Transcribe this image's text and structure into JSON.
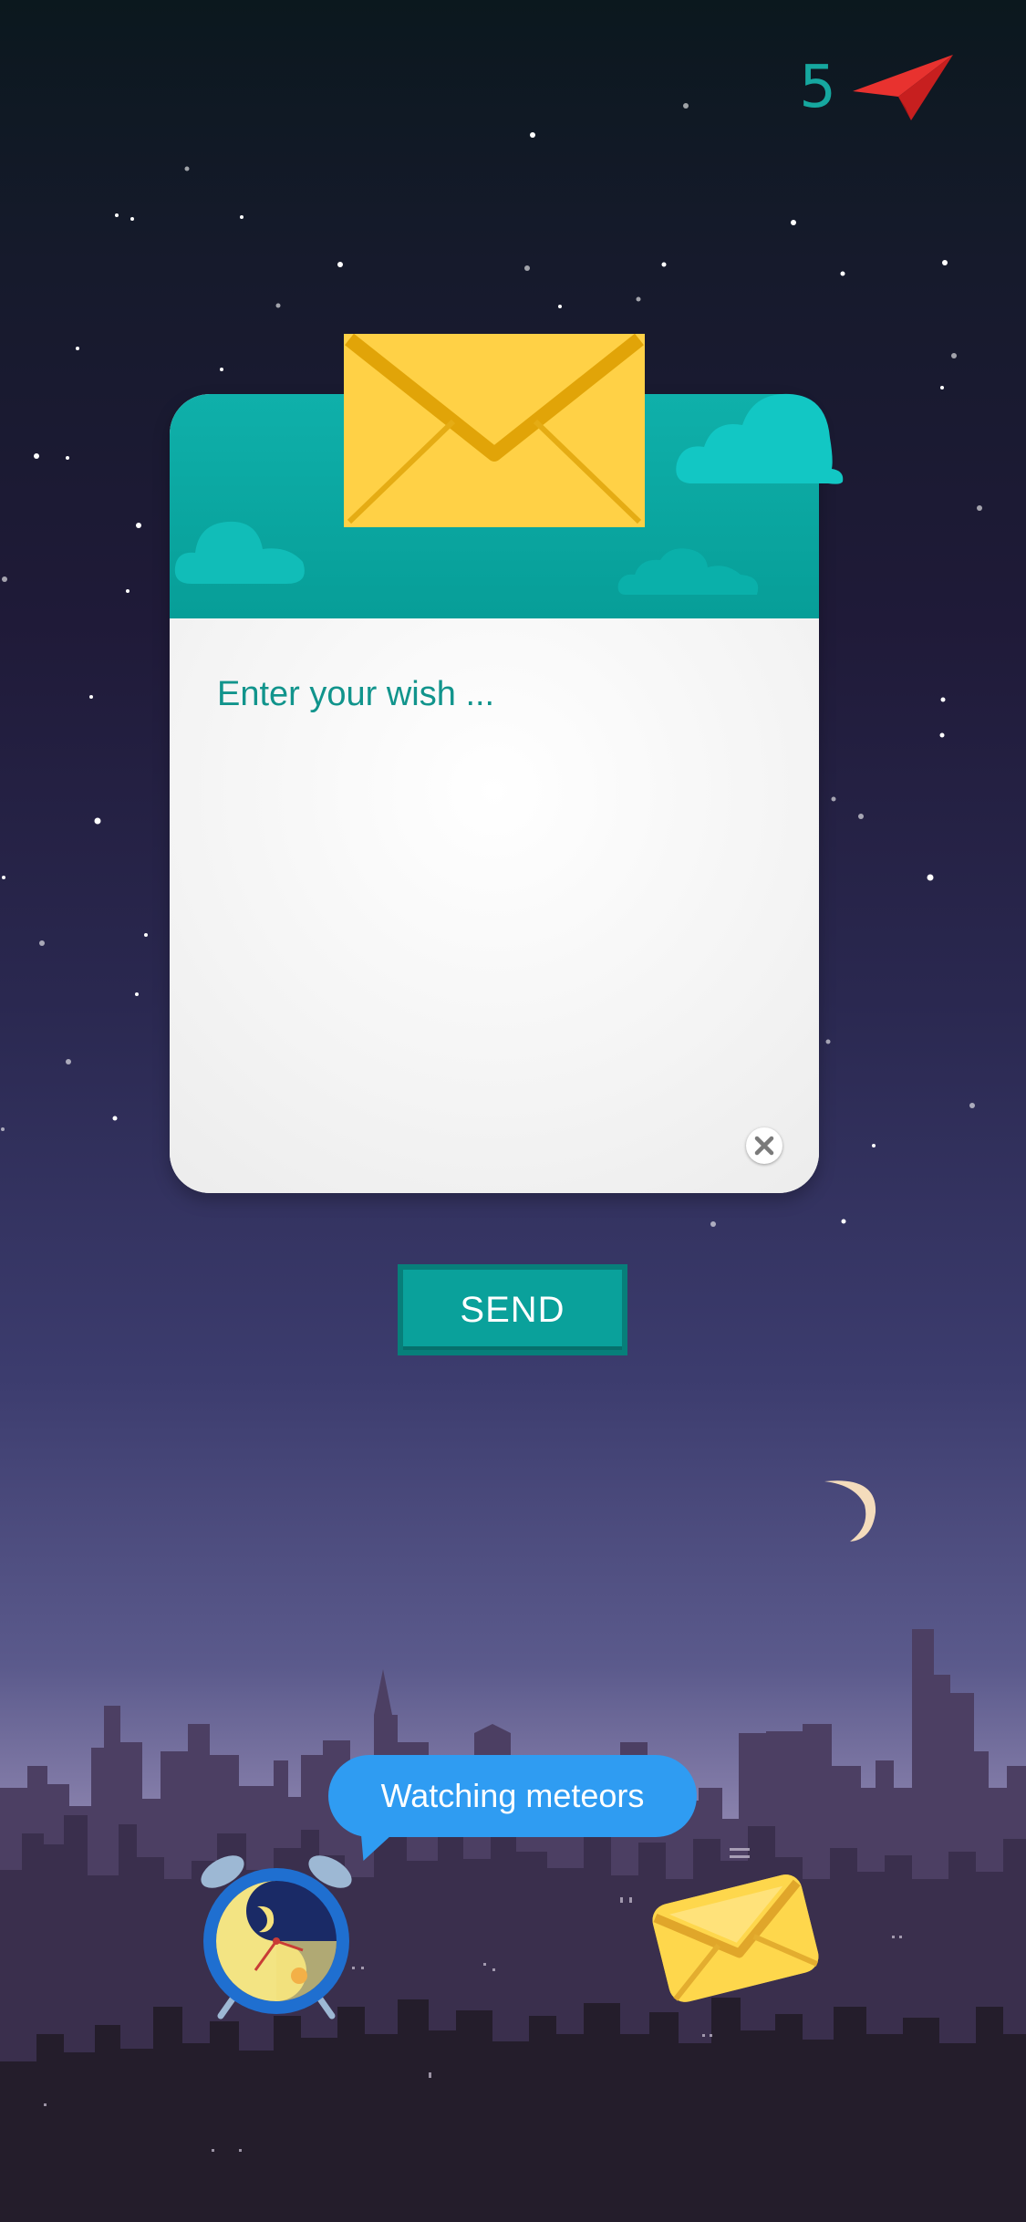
{
  "counter": {
    "value": "5",
    "icon": "paper-plane-icon",
    "color": "#16a79f"
  },
  "wish_card": {
    "placeholder": "Enter your wish ...",
    "value": "",
    "header_color": "#0aa69f",
    "envelope_icon": "envelope-icon",
    "clear_icon": "close-icon"
  },
  "send_button": {
    "label": "SEND",
    "color": "#0aa19b"
  },
  "status_bubble": {
    "text": "Watching meteors",
    "color": "#2f9cf2"
  },
  "bottom_icons": {
    "left": "alarm-clock-icon",
    "right": "mail-icon"
  }
}
